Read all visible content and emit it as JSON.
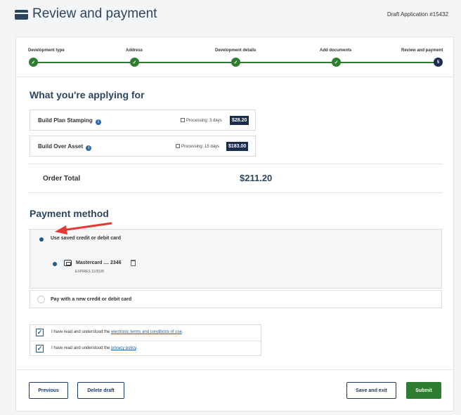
{
  "header": {
    "title": "Review and payment",
    "draft_id": "Draft Application #15432"
  },
  "stepper": {
    "steps": [
      {
        "label": "Development type",
        "status": "complete"
      },
      {
        "label": "Address",
        "status": "complete"
      },
      {
        "label": "Development details",
        "status": "complete"
      },
      {
        "label": "Add documents",
        "status": "complete"
      },
      {
        "label": "Review and payment",
        "status": "current",
        "number": "5"
      }
    ]
  },
  "applying": {
    "title": "What you're applying for",
    "items": [
      {
        "name": "Build Plan Stamping",
        "processing": "Processing: 3 days",
        "price": "$28.20"
      },
      {
        "name": "Build Over Asset",
        "processing": "Processing: 15 days",
        "price": "$183.00"
      }
    ],
    "total_label": "Order Total",
    "total_value": "$211.20"
  },
  "payment": {
    "title": "Payment method",
    "saved_option": "Use saved credit or debit card",
    "card_name": "Mastercard .... 2346",
    "card_expires": "EXPIRES 11/2028",
    "new_option": "Pay with a new credit or debit card"
  },
  "terms": [
    {
      "prefix": "I have read and understood the ",
      "link": "electronic terms and conditions of use",
      "suffix": "."
    },
    {
      "prefix": "I have read and understood the ",
      "link": "privacy policy",
      "suffix": "."
    }
  ],
  "footer": {
    "previous": "Previous",
    "delete": "Delete draft",
    "save_exit": "Save and exit",
    "submit": "Submit"
  },
  "colors": {
    "accent_green": "#2e7d32",
    "navy": "#1b2d4e",
    "annotation_red": "#e53935"
  }
}
